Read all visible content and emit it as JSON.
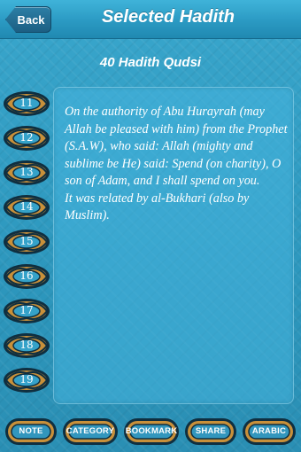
{
  "navbar": {
    "back_label": "Back",
    "title": "Selected Hadith"
  },
  "collection_title": "40 Hadith Qudsi",
  "hadith_numbers": [
    "11",
    "12",
    "13",
    "14",
    "15",
    "16",
    "17",
    "18",
    "19"
  ],
  "hadith": {
    "text": "On the authority of Abu Hurayrah (may Allah be pleased with him) from the Prophet (S.A.W), who said: Allah (mighty and sublime be He) said: Spend (on charity), O son of Adam, and I shall spend on you.",
    "source": "It was related by al-Bukhari (also by Muslim)."
  },
  "toolbar": {
    "note": "NOTE",
    "category": "CATEGORY",
    "bookmark": "BOOKMARK",
    "share": "SHARE",
    "arabic": "ARABIC"
  },
  "colors": {
    "background": "#2f9ac0",
    "ornament_frame": "#0f2f40",
    "ornament_fill": "#c8903a",
    "text": "#ffffff"
  }
}
